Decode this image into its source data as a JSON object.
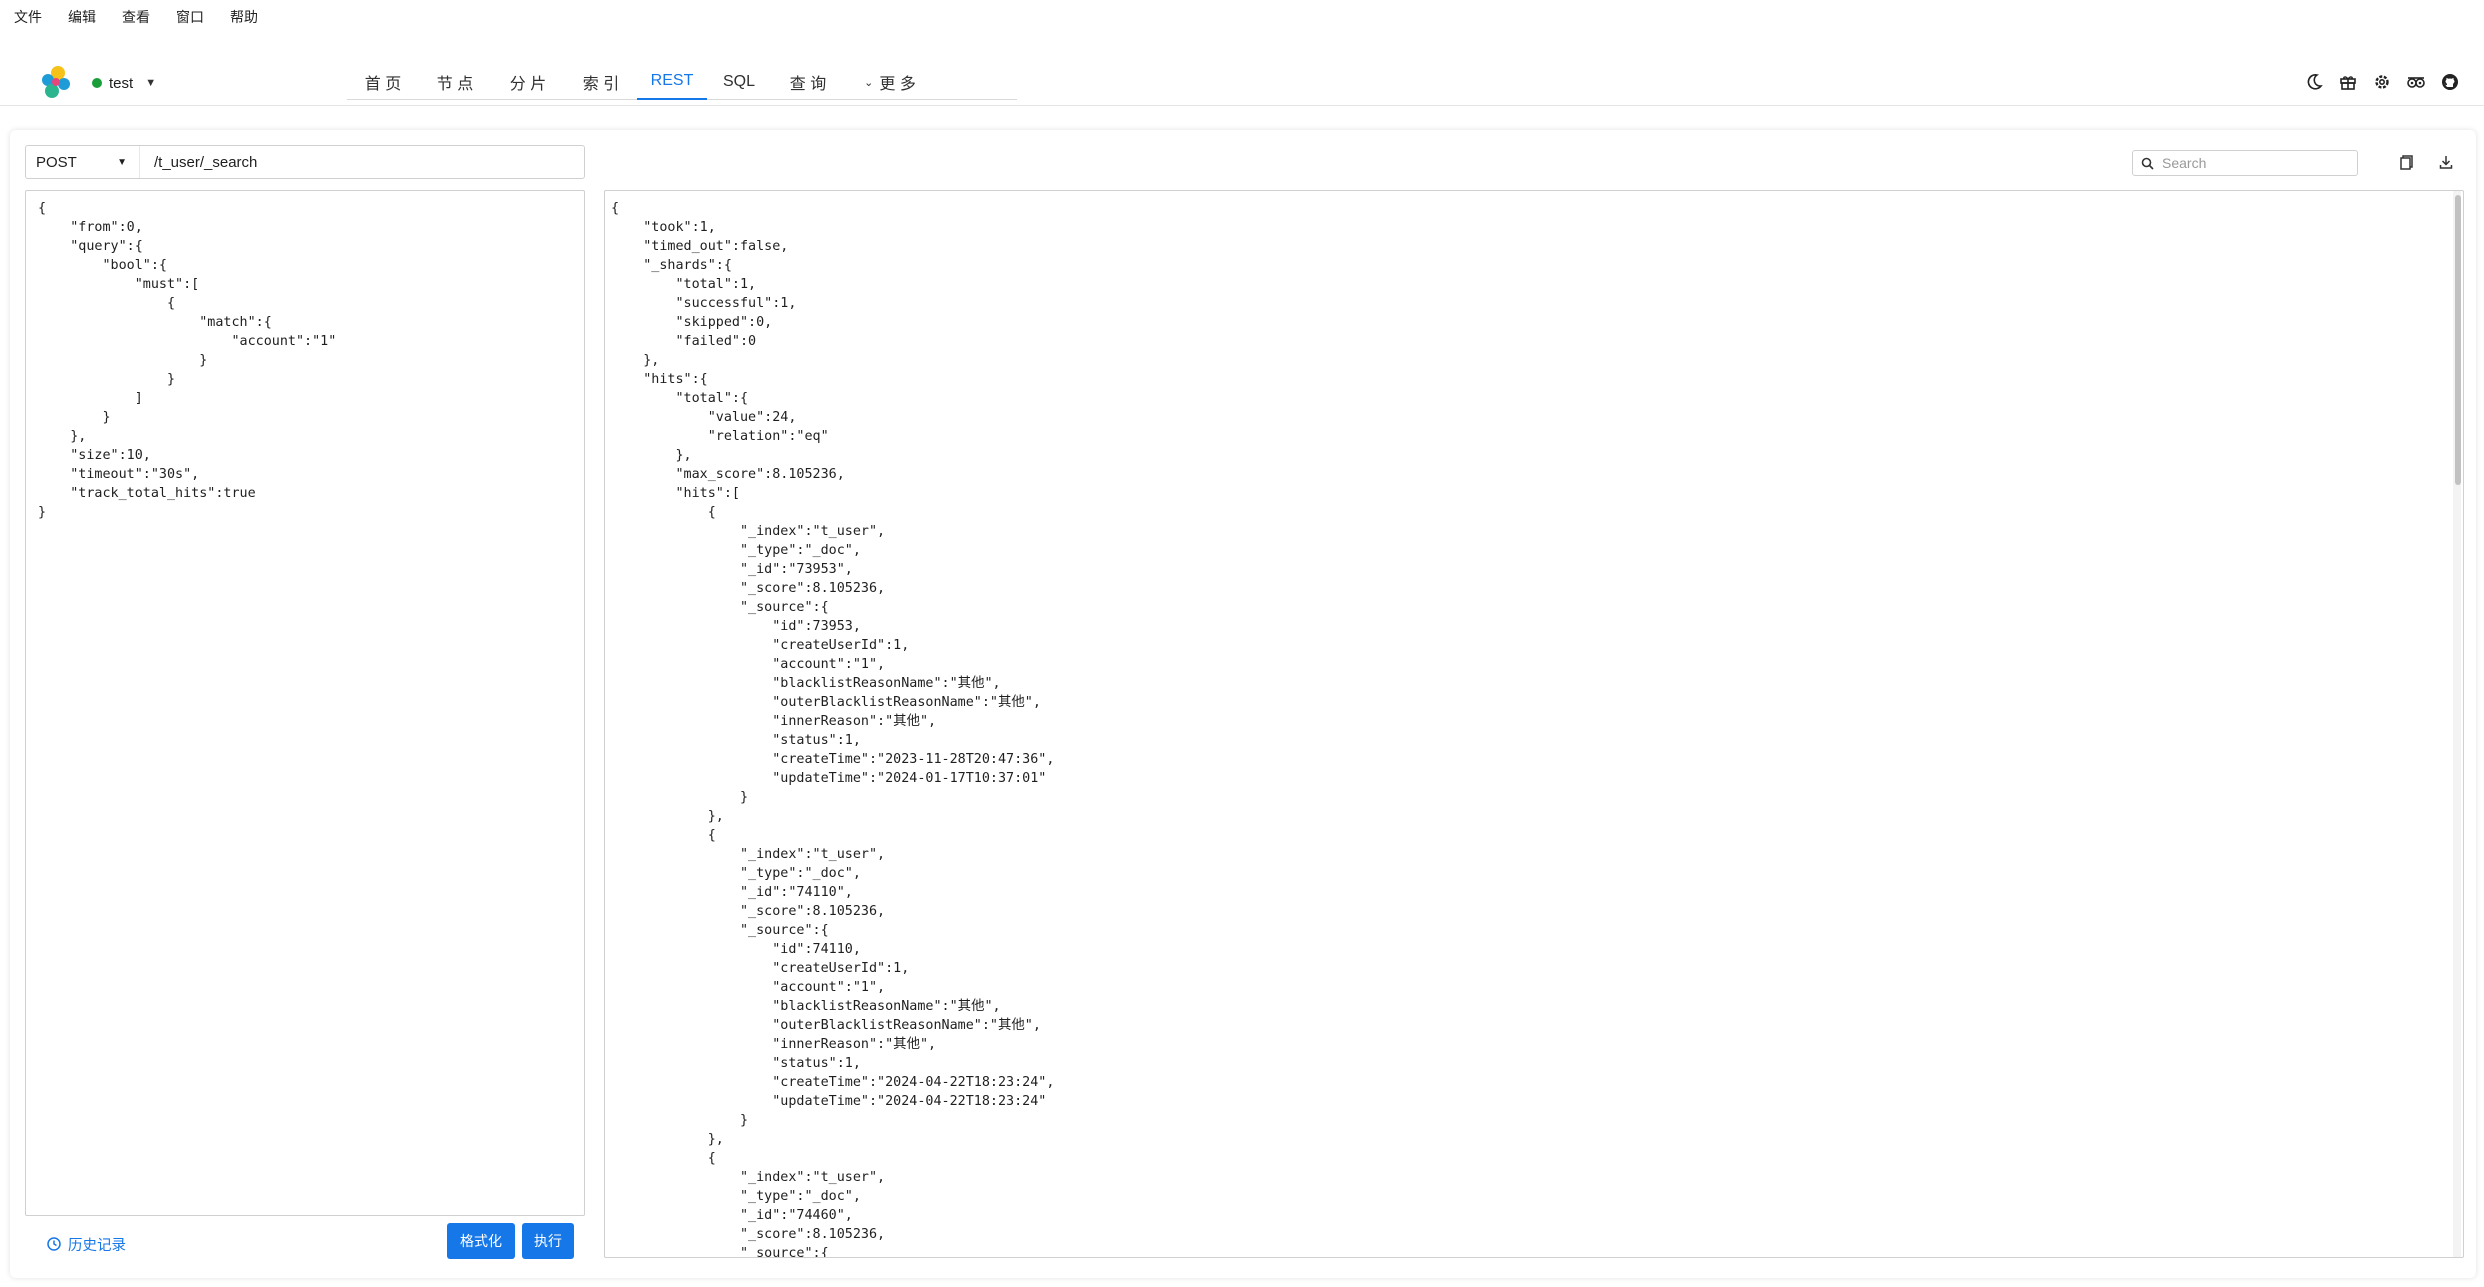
{
  "menu": [
    "文件",
    "编辑",
    "查看",
    "窗口",
    "帮助"
  ],
  "cluster": {
    "name": "test",
    "status_color": "#1a9e3a"
  },
  "tabs": [
    {
      "label": "首 页",
      "icon": ""
    },
    {
      "label": "节 点",
      "icon": ""
    },
    {
      "label": "分 片",
      "icon": ""
    },
    {
      "label": "索 引",
      "icon": ""
    },
    {
      "label": "REST",
      "active": true
    },
    {
      "label": "SQL"
    },
    {
      "label": "查 询"
    },
    {
      "label": "更 多",
      "icon": "chevron-down-icon"
    }
  ],
  "toolbar_icons": [
    "moon-icon",
    "gift-icon",
    "settings-icon",
    "translate-icon",
    "github-icon"
  ],
  "request": {
    "method": "POST",
    "path": "/t_user/_search",
    "body_lines": [
      "{",
      "\t\"from\":0,",
      "\t\"query\":{",
      "\t\t\"bool\":{",
      "\t\t\t\"must\":[",
      "\t\t\t\t{",
      "\t\t\t\t\t\"match\":{",
      "\t\t\t\t\t\t\"account\":\"1\"",
      "\t\t\t\t\t}",
      "\t\t\t\t}",
      "\t\t\t]",
      "\t\t}",
      "\t},",
      "\t\"size\":10,",
      "\t\"timeout\":\"30s\",",
      "\t\"track_total_hits\":true",
      "}"
    ]
  },
  "actions": {
    "history": "历史记录",
    "format": "格式化",
    "execute": "执行"
  },
  "search": {
    "placeholder": "Search"
  },
  "response_lines": [
    "{",
    "\t\"took\":1,",
    "\t\"timed_out\":false,",
    "\t\"_shards\":{",
    "\t\t\"total\":1,",
    "\t\t\"successful\":1,",
    "\t\t\"skipped\":0,",
    "\t\t\"failed\":0",
    "\t},",
    "\t\"hits\":{",
    "\t\t\"total\":{",
    "\t\t\t\"value\":24,",
    "\t\t\t\"relation\":\"eq\"",
    "\t\t},",
    "\t\t\"max_score\":8.105236,",
    "\t\t\"hits\":[",
    "\t\t\t{",
    "\t\t\t\t\"_index\":\"t_user\",",
    "\t\t\t\t\"_type\":\"_doc\",",
    "\t\t\t\t\"_id\":\"73953\",",
    "\t\t\t\t\"_score\":8.105236,",
    "\t\t\t\t\"_source\":{",
    "\t\t\t\t\t\"id\":73953,",
    "\t\t\t\t\t\"createUserId\":1,",
    "\t\t\t\t\t\"account\":\"1\",",
    "\t\t\t\t\t\"blacklistReasonName\":\"其他\",",
    "\t\t\t\t\t\"outerBlacklistReasonName\":\"其他\",",
    "\t\t\t\t\t\"innerReason\":\"其他\",",
    "\t\t\t\t\t\"status\":1,",
    "\t\t\t\t\t\"createTime\":\"2023-11-28T20:47:36\",",
    "\t\t\t\t\t\"updateTime\":\"2024-01-17T10:37:01\"",
    "\t\t\t\t}",
    "\t\t\t},",
    "\t\t\t{",
    "\t\t\t\t\"_index\":\"t_user\",",
    "\t\t\t\t\"_type\":\"_doc\",",
    "\t\t\t\t\"_id\":\"74110\",",
    "\t\t\t\t\"_score\":8.105236,",
    "\t\t\t\t\"_source\":{",
    "\t\t\t\t\t\"id\":74110,",
    "\t\t\t\t\t\"createUserId\":1,",
    "\t\t\t\t\t\"account\":\"1\",",
    "\t\t\t\t\t\"blacklistReasonName\":\"其他\",",
    "\t\t\t\t\t\"outerBlacklistReasonName\":\"其他\",",
    "\t\t\t\t\t\"innerReason\":\"其他\",",
    "\t\t\t\t\t\"status\":1,",
    "\t\t\t\t\t\"createTime\":\"2024-04-22T18:23:24\",",
    "\t\t\t\t\t\"updateTime\":\"2024-04-22T18:23:24\"",
    "\t\t\t\t}",
    "\t\t\t},",
    "\t\t\t{",
    "\t\t\t\t\"_index\":\"t_user\",",
    "\t\t\t\t\"_type\":\"_doc\",",
    "\t\t\t\t\"_id\":\"74460\",",
    "\t\t\t\t\"_score\":8.105236,",
    "\t\t\t\t\"_source\":{"
  ],
  "colors": {
    "accent": "#1677e8"
  }
}
